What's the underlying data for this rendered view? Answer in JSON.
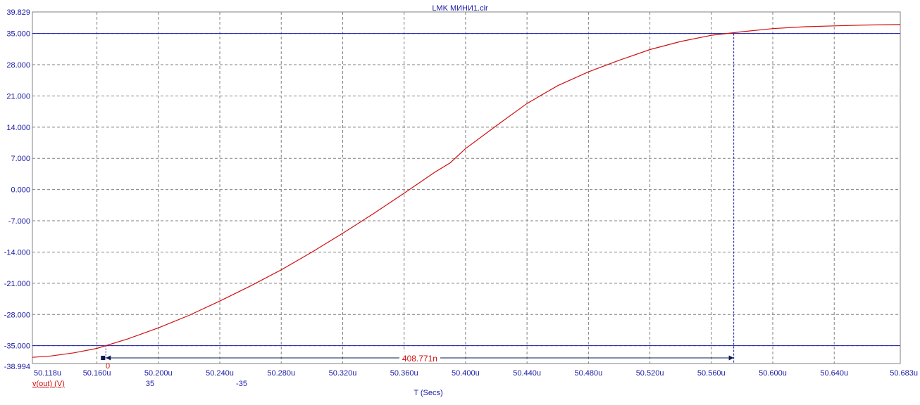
{
  "window": {
    "title": "LMK МИНИ1.cir"
  },
  "chart_data": {
    "type": "line",
    "title": "LMK МИНИ1.cir",
    "xlabel": "T (Secs)",
    "ylabel": "",
    "xlim": [
      50.118,
      50.683
    ],
    "ylim": [
      -38.994,
      39.829
    ],
    "x_unit_suffix": "u",
    "x_ticks": [
      50.16,
      50.2,
      50.24,
      50.28,
      50.32,
      50.36,
      50.4,
      50.44,
      50.48,
      50.52,
      50.56,
      50.6,
      50.64
    ],
    "x_tick_labels": [
      "50.160u",
      "50.200u",
      "50.240u",
      "50.280u",
      "50.320u",
      "50.360u",
      "50.400u",
      "50.440u",
      "50.480u",
      "50.520u",
      "50.560u",
      "50.600u",
      "50.640u"
    ],
    "x_min_label": "50.118u",
    "x_max_label": "50.683u",
    "y_ticks": [
      35.0,
      28.0,
      21.0,
      14.0,
      7.0,
      0.0,
      -7.0,
      -14.0,
      -21.0,
      -28.0,
      -35.0
    ],
    "y_tick_labels": [
      "35.000",
      "28.000",
      "21.000",
      "14.000",
      "7.000",
      "0.000",
      "-7.000",
      "-14.000",
      "-21.000",
      "-28.000",
      "-35.000"
    ],
    "y_max_label": "39.829",
    "y_min_label": "-38.994",
    "grid": true,
    "series": [
      {
        "name": "v(out) (V)",
        "color": "#d01010",
        "x": [
          50.118,
          50.13,
          50.145,
          50.16,
          50.18,
          50.2,
          50.22,
          50.24,
          50.26,
          50.28,
          50.3,
          50.32,
          50.34,
          50.36,
          50.38,
          50.39,
          50.4,
          50.42,
          50.44,
          50.46,
          50.48,
          50.5,
          50.52,
          50.54,
          50.56,
          50.58,
          50.6,
          50.62,
          50.64,
          50.66,
          50.683
        ],
        "y": [
          -37.6,
          -37.3,
          -36.6,
          -35.6,
          -33.5,
          -31.0,
          -28.2,
          -25.0,
          -21.6,
          -18.0,
          -14.0,
          -9.8,
          -5.4,
          -0.8,
          3.9,
          6.0,
          9.2,
          14.3,
          19.3,
          23.3,
          26.4,
          29.0,
          31.4,
          33.2,
          34.6,
          35.4,
          36.1,
          36.5,
          36.7,
          36.9,
          37.0
        ]
      }
    ],
    "horizontal_cursor_lines": [
      35.0,
      -35.0
    ],
    "cursor_left_x": 50.1658,
    "cursor_right_x": 50.5746,
    "measurement": {
      "label": "408.771n",
      "value_ns": 408.771
    },
    "bottom_readouts": {
      "series_label": "v(out) (V)",
      "cursor_left_value": "35",
      "cursor_right_value": "-35",
      "cursor_index": "0"
    },
    "colors": {
      "axis": "#1a1aa6",
      "grid": "#808080",
      "trace": "#d01010",
      "cursor": "#1a1aa6",
      "measure": "#0a1a50"
    }
  }
}
